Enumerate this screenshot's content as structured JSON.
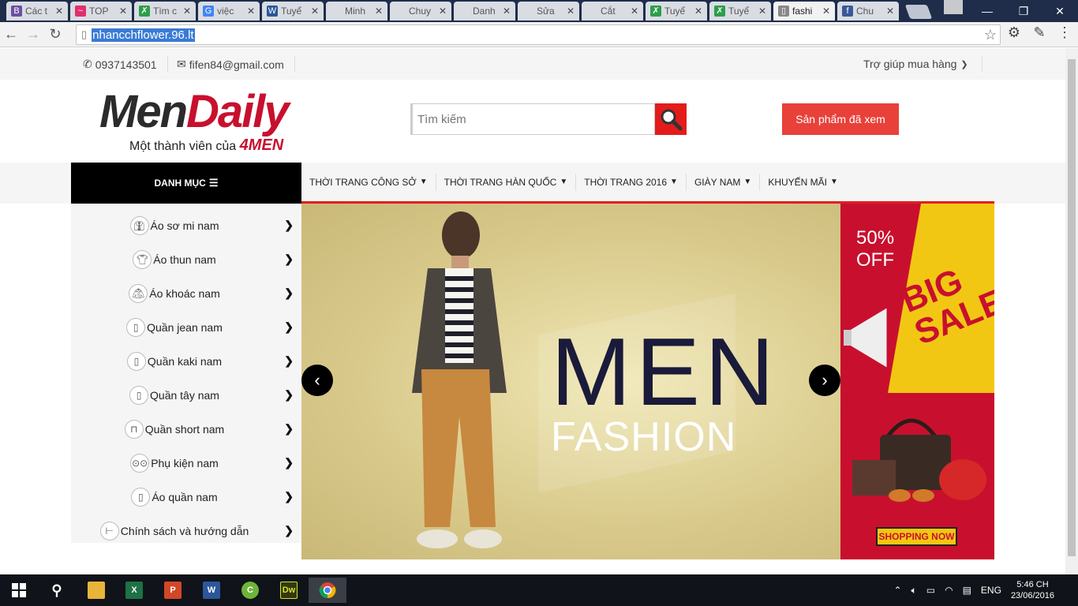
{
  "browser": {
    "tabs": [
      {
        "label": "Các t",
        "fav": "B",
        "color": "#6c4fa0"
      },
      {
        "label": "TOP",
        "fav": "~",
        "color": "#e0306c"
      },
      {
        "label": "Tìm c",
        "fav": "✗",
        "color": "#2e9e4a"
      },
      {
        "label": "việc",
        "fav": "G",
        "color": "#4285f4"
      },
      {
        "label": "Tuyể",
        "fav": "W",
        "color": "#2b579a"
      },
      {
        "label": "Minh",
        "fav": "",
        "color": "#d9dde3"
      },
      {
        "label": "Chuy",
        "fav": "",
        "color": "#d9dde3"
      },
      {
        "label": "Danh",
        "fav": "",
        "color": "#d9dde3"
      },
      {
        "label": "Sửa",
        "fav": "",
        "color": "#d9dde3"
      },
      {
        "label": "Cắt",
        "fav": "",
        "color": "#d9dde3"
      },
      {
        "label": "Tuyể",
        "fav": "✗",
        "color": "#2e9e4a"
      },
      {
        "label": "Tuyể",
        "fav": "✗",
        "color": "#2e9e4a"
      },
      {
        "label": "fashi",
        "fav": "▯",
        "color": "#888"
      },
      {
        "label": "Chu",
        "fav": "f",
        "color": "#3b5998"
      }
    ],
    "url": "nhancchflower.96.lt"
  },
  "topbar": {
    "phone": "0937143501",
    "email": "fifen84@gmail.com",
    "help": "Trợ giúp mua hàng"
  },
  "header": {
    "logo_men": "Men",
    "logo_daily": "Daily",
    "tagline": "Một thành viên của",
    "tagline_brand": "4MEN",
    "search_placeholder": "Tìm kiếm",
    "viewed_button": "Sản phẩm đã xem"
  },
  "nav": {
    "category_label": "DANH MỤC",
    "items": [
      "THỜI TRANG CÔNG SỞ",
      "THỜI TRANG HÀN QUỐC",
      "THỜI TRANG 2016",
      "GIÀY NAM",
      "KHUYẾN MÃI"
    ]
  },
  "categories": [
    {
      "label": "Áo sơ mi nam",
      "icon": "shirt-icon"
    },
    {
      "label": "Áo thun nam",
      "icon": "tshirt-icon"
    },
    {
      "label": "Áo khoác nam",
      "icon": "jacket-icon"
    },
    {
      "label": "Quần jean nam",
      "icon": "jeans-icon"
    },
    {
      "label": "Quần kaki nam",
      "icon": "khaki-icon"
    },
    {
      "label": "Quần tây nam",
      "icon": "trousers-icon"
    },
    {
      "label": "Quần short nam",
      "icon": "shorts-icon"
    },
    {
      "label": "Phụ kiện nam",
      "icon": "glasses-icon"
    },
    {
      "label": "Áo quần nam",
      "icon": "suit-icon"
    },
    {
      "label": "Chính sách và hướng dẫn",
      "icon": "signpost-icon"
    }
  ],
  "slider": {
    "line1": "MEN",
    "line2": "FASHION",
    "prev": "‹",
    "next": "›"
  },
  "banner": {
    "percent": "50%",
    "off": "OFF",
    "big": "BIG",
    "sale": "SALE",
    "cta": "SHOPPING NOW"
  },
  "taskbar": {
    "lang": "ENG",
    "time": "5:46 CH",
    "date": "23/06/2016"
  },
  "colors": {
    "accent_red": "#e21e1e",
    "nav_black": "#000000"
  }
}
